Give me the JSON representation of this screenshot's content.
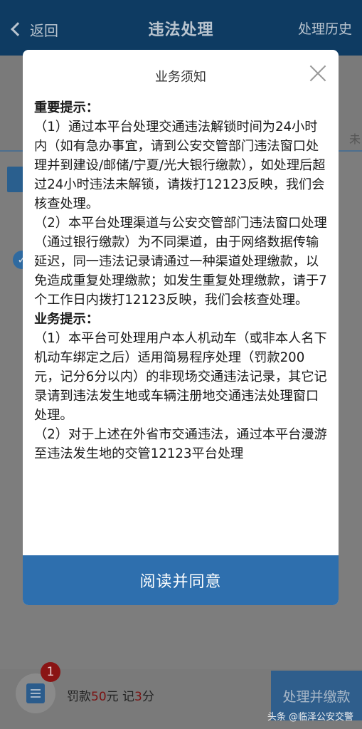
{
  "nav": {
    "back_label": "返回",
    "title": "违法处理",
    "history_label": "处理历史"
  },
  "background": {
    "right_char": "未",
    "check_icon": "checkmark-icon"
  },
  "modal": {
    "title": "业务须知",
    "close_icon": "close-icon",
    "section1_heading": "重要提示：",
    "section1_p1": "（1）通过本平台处理交通违法解锁时间为24小时内（如有急办事宜，请到公安交管部门违法窗口处理并到建设/邮储/宁夏/光大银行缴款），如处理后超过24小时违法未解锁，请拨打12123反映，我们会核查处理。",
    "section1_p2": "（2）本平台处理渠道与公安交管部门违法窗口处理（通过银行缴款）为不同渠道，由于网络数据传输延迟，同一违法记录请通过一种渠道处理缴款，以免造成重复处理缴款；如发生重复处理缴款，请于7个工作日内拨打12123反映，我们会核查处理。",
    "section2_heading": "业务提示：",
    "section2_p1": "（1）本平台可处理用户本人机动车（或非本人名下机动车绑定之后）适用简易程序处理（罚款200元，记分6分以内）的非现场交通违法记录，其它记录请到违法发生地或车辆注册地交通违法处理窗口处理。",
    "section2_p2": "（2）对于上述在外省市交通违法，通过本平台漫游至违法发生地的交管12123平台处理",
    "agree_label": "阅读并同意"
  },
  "bottom": {
    "badge_count": "1",
    "fine_prefix": "罚款",
    "fine_amount": "50",
    "fine_unit": "元 记",
    "points": "3",
    "points_unit": "分",
    "pay_button_label": "处理并缴款",
    "watermark": "头条 @临泽公安交警"
  },
  "colors": {
    "nav_bg": "#0e3b62",
    "agree_bg": "#2e6fae",
    "badge_bg": "#8a1414"
  }
}
